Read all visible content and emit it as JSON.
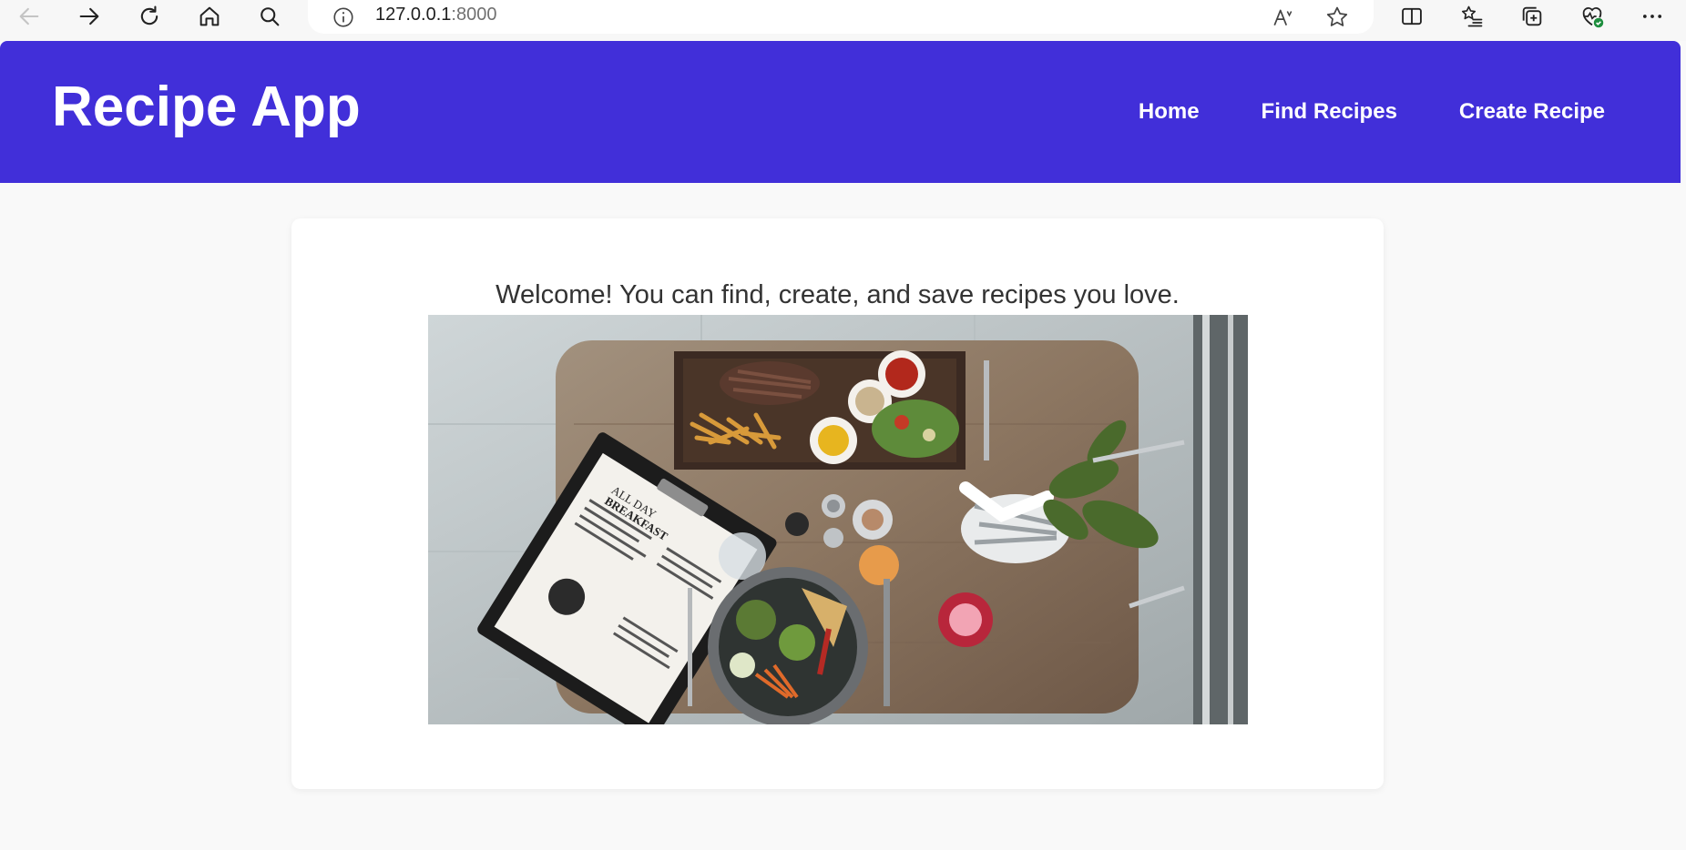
{
  "browser": {
    "url_host": "127.0.0.1",
    "url_port": ":8000"
  },
  "header": {
    "title": "Recipe App",
    "nav": [
      {
        "label": "Home"
      },
      {
        "label": "Find Recipes"
      },
      {
        "label": "Create Recipe"
      }
    ]
  },
  "main": {
    "welcome": "Welcome! You can find, create, and save recipes you love.",
    "menu_card_lines": [
      "ALL DAY",
      "BREAKFAST"
    ]
  },
  "colors": {
    "header_bg": "#412fd9",
    "page_bg": "#f9f9f9",
    "card_bg": "#ffffff",
    "text": "#333333"
  },
  "icons": [
    "back-arrow-icon",
    "forward-arrow-icon",
    "reload-icon",
    "home-icon",
    "search-icon",
    "info-icon",
    "read-aloud-icon",
    "favorite-star-icon",
    "split-screen-icon",
    "favorites-list-icon",
    "collections-icon",
    "browser-essentials-icon",
    "more-options-icon"
  ]
}
